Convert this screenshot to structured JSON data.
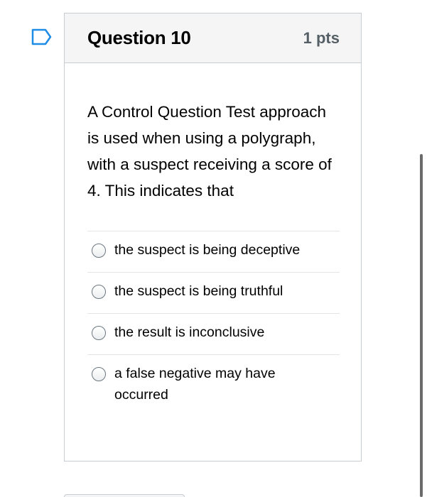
{
  "question": {
    "title": "Question 10",
    "points": "1 pts",
    "text": "A Control Question Test approach is used when using a polygraph, with a suspect receiving a score of 4. This indicates that",
    "flag_icon": "flag-question-icon",
    "answers": [
      {
        "label": "the suspect is being deceptive",
        "selected": false
      },
      {
        "label": "the suspect is being truthful",
        "selected": false
      },
      {
        "label": "the result is inconclusive",
        "selected": false
      },
      {
        "label": "a false negative may have occurred",
        "selected": false
      }
    ]
  },
  "colors": {
    "flag_border": "#1f8ce6",
    "header_bg": "#f5f5f5",
    "border": "#c7cdd1"
  }
}
